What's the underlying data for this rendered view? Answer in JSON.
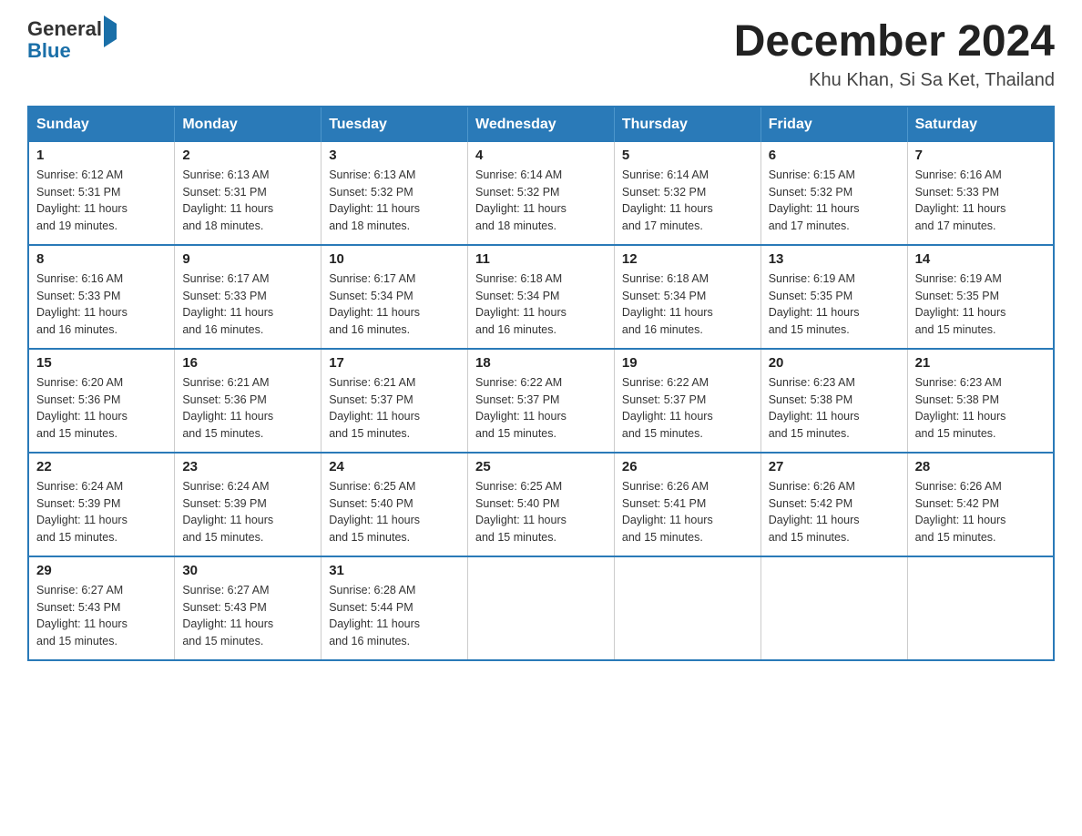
{
  "header": {
    "logo_general": "General",
    "logo_blue": "Blue",
    "month_title": "December 2024",
    "subtitle": "Khu Khan, Si Sa Ket, Thailand"
  },
  "days_of_week": [
    "Sunday",
    "Monday",
    "Tuesday",
    "Wednesday",
    "Thursday",
    "Friday",
    "Saturday"
  ],
  "weeks": [
    [
      {
        "day": "1",
        "sunrise": "6:12 AM",
        "sunset": "5:31 PM",
        "daylight": "11 hours and 19 minutes."
      },
      {
        "day": "2",
        "sunrise": "6:13 AM",
        "sunset": "5:31 PM",
        "daylight": "11 hours and 18 minutes."
      },
      {
        "day": "3",
        "sunrise": "6:13 AM",
        "sunset": "5:32 PM",
        "daylight": "11 hours and 18 minutes."
      },
      {
        "day": "4",
        "sunrise": "6:14 AM",
        "sunset": "5:32 PM",
        "daylight": "11 hours and 18 minutes."
      },
      {
        "day": "5",
        "sunrise": "6:14 AM",
        "sunset": "5:32 PM",
        "daylight": "11 hours and 17 minutes."
      },
      {
        "day": "6",
        "sunrise": "6:15 AM",
        "sunset": "5:32 PM",
        "daylight": "11 hours and 17 minutes."
      },
      {
        "day": "7",
        "sunrise": "6:16 AM",
        "sunset": "5:33 PM",
        "daylight": "11 hours and 17 minutes."
      }
    ],
    [
      {
        "day": "8",
        "sunrise": "6:16 AM",
        "sunset": "5:33 PM",
        "daylight": "11 hours and 16 minutes."
      },
      {
        "day": "9",
        "sunrise": "6:17 AM",
        "sunset": "5:33 PM",
        "daylight": "11 hours and 16 minutes."
      },
      {
        "day": "10",
        "sunrise": "6:17 AM",
        "sunset": "5:34 PM",
        "daylight": "11 hours and 16 minutes."
      },
      {
        "day": "11",
        "sunrise": "6:18 AM",
        "sunset": "5:34 PM",
        "daylight": "11 hours and 16 minutes."
      },
      {
        "day": "12",
        "sunrise": "6:18 AM",
        "sunset": "5:34 PM",
        "daylight": "11 hours and 16 minutes."
      },
      {
        "day": "13",
        "sunrise": "6:19 AM",
        "sunset": "5:35 PM",
        "daylight": "11 hours and 15 minutes."
      },
      {
        "day": "14",
        "sunrise": "6:19 AM",
        "sunset": "5:35 PM",
        "daylight": "11 hours and 15 minutes."
      }
    ],
    [
      {
        "day": "15",
        "sunrise": "6:20 AM",
        "sunset": "5:36 PM",
        "daylight": "11 hours and 15 minutes."
      },
      {
        "day": "16",
        "sunrise": "6:21 AM",
        "sunset": "5:36 PM",
        "daylight": "11 hours and 15 minutes."
      },
      {
        "day": "17",
        "sunrise": "6:21 AM",
        "sunset": "5:37 PM",
        "daylight": "11 hours and 15 minutes."
      },
      {
        "day": "18",
        "sunrise": "6:22 AM",
        "sunset": "5:37 PM",
        "daylight": "11 hours and 15 minutes."
      },
      {
        "day": "19",
        "sunrise": "6:22 AM",
        "sunset": "5:37 PM",
        "daylight": "11 hours and 15 minutes."
      },
      {
        "day": "20",
        "sunrise": "6:23 AM",
        "sunset": "5:38 PM",
        "daylight": "11 hours and 15 minutes."
      },
      {
        "day": "21",
        "sunrise": "6:23 AM",
        "sunset": "5:38 PM",
        "daylight": "11 hours and 15 minutes."
      }
    ],
    [
      {
        "day": "22",
        "sunrise": "6:24 AM",
        "sunset": "5:39 PM",
        "daylight": "11 hours and 15 minutes."
      },
      {
        "day": "23",
        "sunrise": "6:24 AM",
        "sunset": "5:39 PM",
        "daylight": "11 hours and 15 minutes."
      },
      {
        "day": "24",
        "sunrise": "6:25 AM",
        "sunset": "5:40 PM",
        "daylight": "11 hours and 15 minutes."
      },
      {
        "day": "25",
        "sunrise": "6:25 AM",
        "sunset": "5:40 PM",
        "daylight": "11 hours and 15 minutes."
      },
      {
        "day": "26",
        "sunrise": "6:26 AM",
        "sunset": "5:41 PM",
        "daylight": "11 hours and 15 minutes."
      },
      {
        "day": "27",
        "sunrise": "6:26 AM",
        "sunset": "5:42 PM",
        "daylight": "11 hours and 15 minutes."
      },
      {
        "day": "28",
        "sunrise": "6:26 AM",
        "sunset": "5:42 PM",
        "daylight": "11 hours and 15 minutes."
      }
    ],
    [
      {
        "day": "29",
        "sunrise": "6:27 AM",
        "sunset": "5:43 PM",
        "daylight": "11 hours and 15 minutes."
      },
      {
        "day": "30",
        "sunrise": "6:27 AM",
        "sunset": "5:43 PM",
        "daylight": "11 hours and 15 minutes."
      },
      {
        "day": "31",
        "sunrise": "6:28 AM",
        "sunset": "5:44 PM",
        "daylight": "11 hours and 16 minutes."
      },
      null,
      null,
      null,
      null
    ]
  ],
  "labels": {
    "sunrise_prefix": "Sunrise: ",
    "sunset_prefix": "Sunset: ",
    "daylight_prefix": "Daylight: "
  }
}
